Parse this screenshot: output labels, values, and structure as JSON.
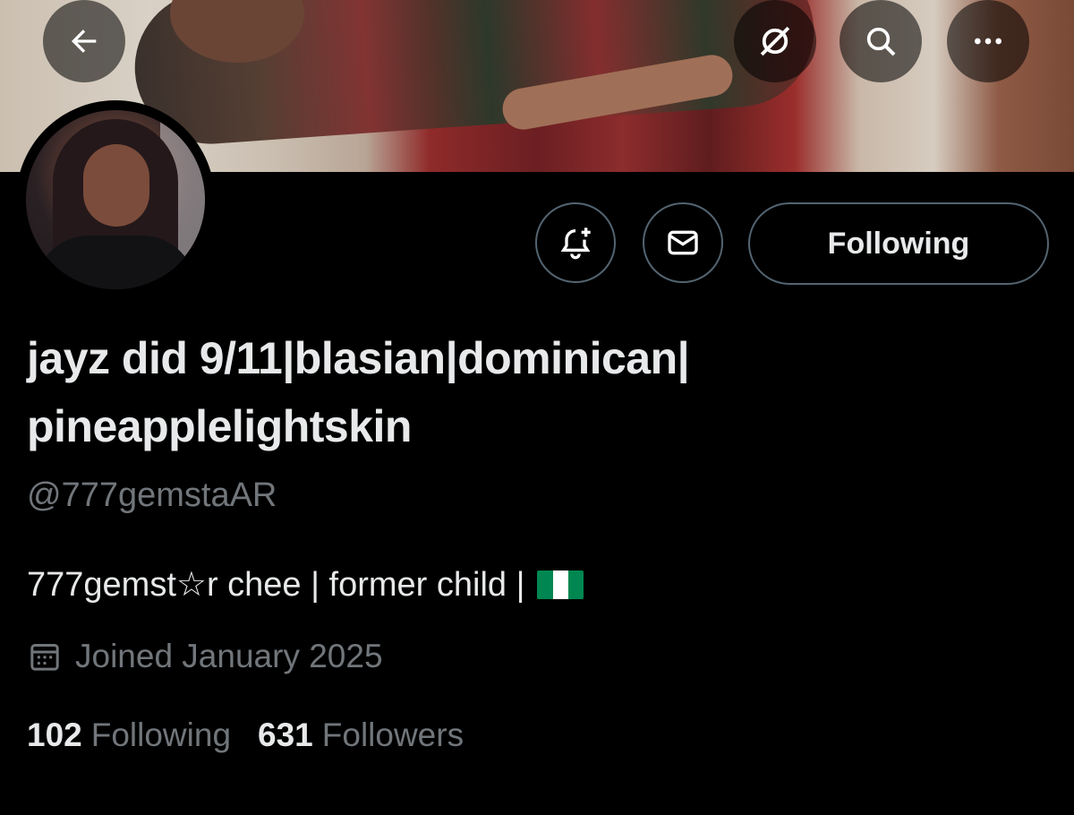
{
  "header": {
    "back_icon": "arrow-left-icon",
    "grok_icon": "grok-icon",
    "search_icon": "search-icon",
    "more_icon": "more-horizontal-icon"
  },
  "actions": {
    "notify_icon": "bell-plus-icon",
    "message_icon": "envelope-icon",
    "follow_label": "Following"
  },
  "profile": {
    "name_line1": "jayz did 9/11|blasian|dominican|",
    "name_line2": "pineapplelightskin",
    "handle": "@777gemstaAR",
    "bio": "777gemst☆r chee | former child |",
    "bio_flag": "flag-nigeria-icon",
    "joined": "Joined January 2025",
    "following_count": "102",
    "following_label": "Following",
    "followers_count": "631",
    "followers_label": "Followers"
  },
  "colors": {
    "background": "#000000",
    "text_primary": "#e7e9ea",
    "text_secondary": "#71767b",
    "border": "#536471",
    "flag_green": "#008751",
    "flag_white": "#ffffff"
  }
}
